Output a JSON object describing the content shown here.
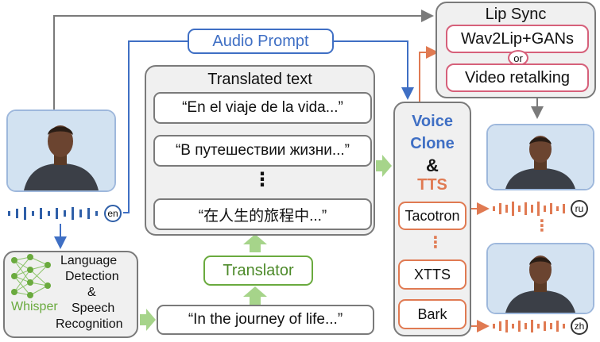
{
  "lip_sync": {
    "title": "Lip Sync",
    "option_a": "Wav2Lip+GANs",
    "or": "or",
    "option_b": "Video retalking"
  },
  "audio_prompt": "Audio Prompt",
  "translated": {
    "title": "Translated text",
    "items": [
      "“En el viaje de la vida...”",
      "“В путешествии жизни...”",
      "⋮",
      "“在人生的旅程中...”"
    ]
  },
  "voice": {
    "line1": "Voice",
    "line2": "Clone",
    "amp": "&",
    "line3": "TTS",
    "models": [
      "Tacotron",
      "XTTS",
      "Bark"
    ],
    "dots": "⋮"
  },
  "translator": "Translator",
  "source_text": "“In the journey of life...”",
  "asr": {
    "line1": "Language",
    "line2": "Detection",
    "line3": "&",
    "line4": "Speech",
    "line5": "Recognition",
    "whisper": "Whisper"
  },
  "languages": {
    "source": "en",
    "out_top": "ru",
    "out_bottom": "zh"
  },
  "outputs_dots": "⋮",
  "colors": {
    "blue": "#3f6fc4",
    "green": "#6aaa3e",
    "orange": "#e07a52",
    "pink": "#d6607a",
    "gray": "#7a7a7a"
  }
}
